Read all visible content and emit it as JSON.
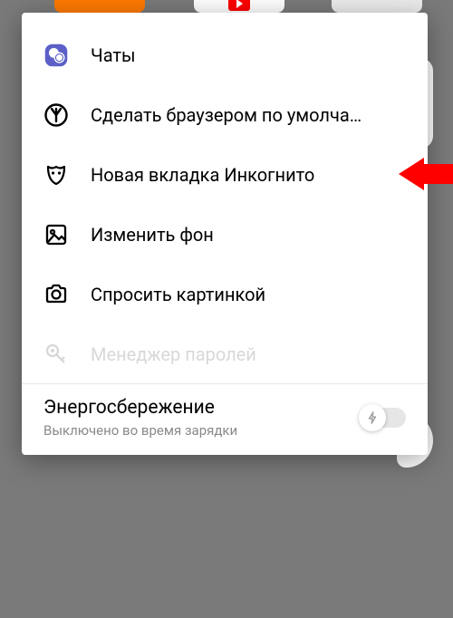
{
  "menu": {
    "items": [
      {
        "label": "Чаты"
      },
      {
        "label": "Сделать браузером по умолчанию"
      },
      {
        "label": "Новая вкладка Инкогнито"
      },
      {
        "label": "Изменить фон"
      },
      {
        "label": "Спросить картинкой"
      },
      {
        "label": "Менеджер паролей"
      }
    ]
  },
  "energy": {
    "title": "Энергосбережение",
    "subtitle": "Выключено во время зарядки",
    "enabled": false
  },
  "colors": {
    "chat_icon": "#5b5fc7",
    "arrow": "#ff0000"
  }
}
